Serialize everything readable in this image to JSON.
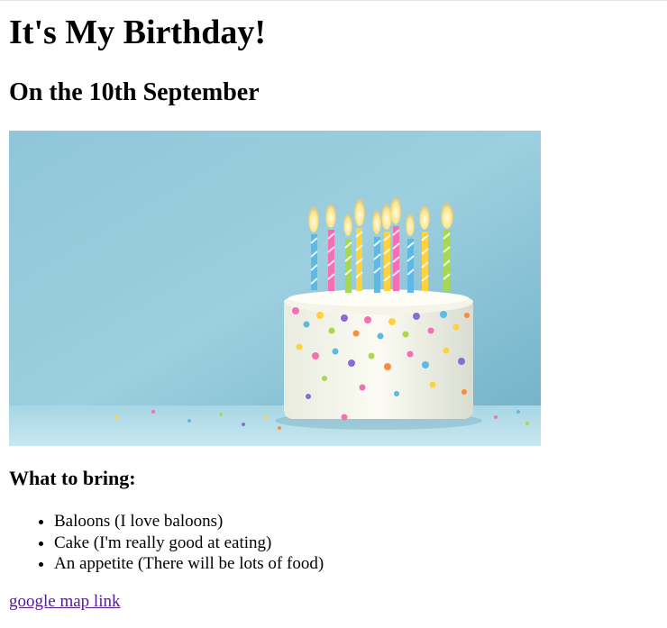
{
  "page": {
    "heading": "It's My Birthday!",
    "subheading": "On the 10th September",
    "bring_title": "What to bring:",
    "bring_items": [
      "Baloons (I love baloons)",
      "Cake (I'm really good at eating)",
      "An appetite (There will be lots of food)"
    ],
    "map_link_label": "google map link"
  },
  "image": {
    "subject": "birthday cake with lit candles and colorful sprinkles"
  },
  "colors": {
    "visited_link": "#551a8b",
    "background": "#ffffff"
  }
}
